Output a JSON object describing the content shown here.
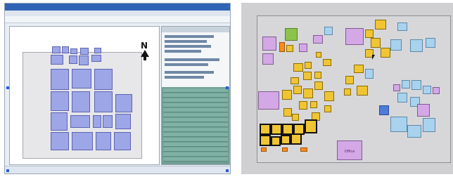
{
  "left_panel": {
    "window_title": "",
    "north_label": "N"
  },
  "right_panel": {
    "labels": {
      "top_right_tile": "",
      "left_tile": "",
      "bottom_tile": "Office"
    }
  },
  "colors": {
    "yellow": "#f0c534",
    "purple": "#d4a8e6",
    "light_blue": "#a9d2ee",
    "green": "#8cc34a",
    "blue": "#4e7bd8",
    "orange": "#ff8a1d"
  }
}
